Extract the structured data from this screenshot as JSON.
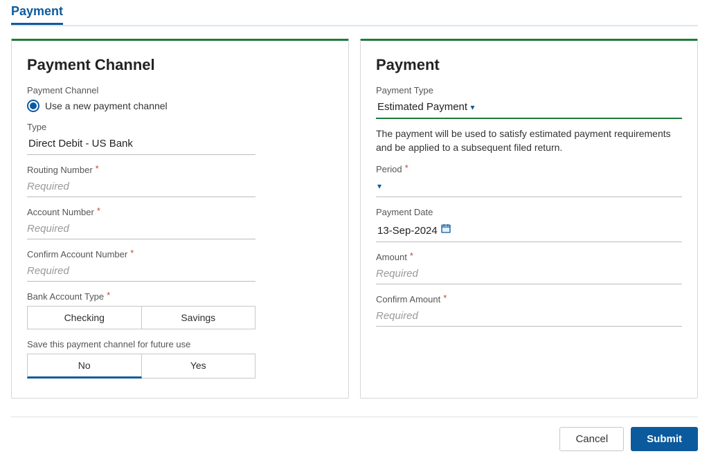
{
  "header": {
    "title": "Payment"
  },
  "left": {
    "heading": "Payment Channel",
    "lbl_channel": "Payment Channel",
    "radio_label": "Use a new payment channel",
    "lbl_type": "Type",
    "type_value": "Direct Debit - US Bank",
    "lbl_routing": "Routing Number",
    "ph_required": "Required",
    "lbl_account": "Account Number",
    "lbl_confirm_account": "Confirm Account Number",
    "lbl_bank_type": "Bank Account Type",
    "opt_checking": "Checking",
    "opt_savings": "Savings",
    "lbl_save": "Save this payment channel for future use",
    "opt_no": "No",
    "opt_yes": "Yes"
  },
  "right": {
    "heading": "Payment",
    "lbl_ptype": "Payment Type",
    "ptype_value": "Estimated Payment",
    "helper": "The payment will be used to satisfy estimated payment requirements and be applied to a subsequent filed return.",
    "lbl_period": "Period",
    "period_value": "",
    "lbl_date": "Payment Date",
    "date_value": "13-Sep-2024",
    "lbl_amount": "Amount",
    "lbl_confirm_amount": "Confirm Amount",
    "ph_required": "Required"
  },
  "footer": {
    "cancel": "Cancel",
    "submit": "Submit"
  },
  "misc": {
    "asterisk": "*"
  }
}
